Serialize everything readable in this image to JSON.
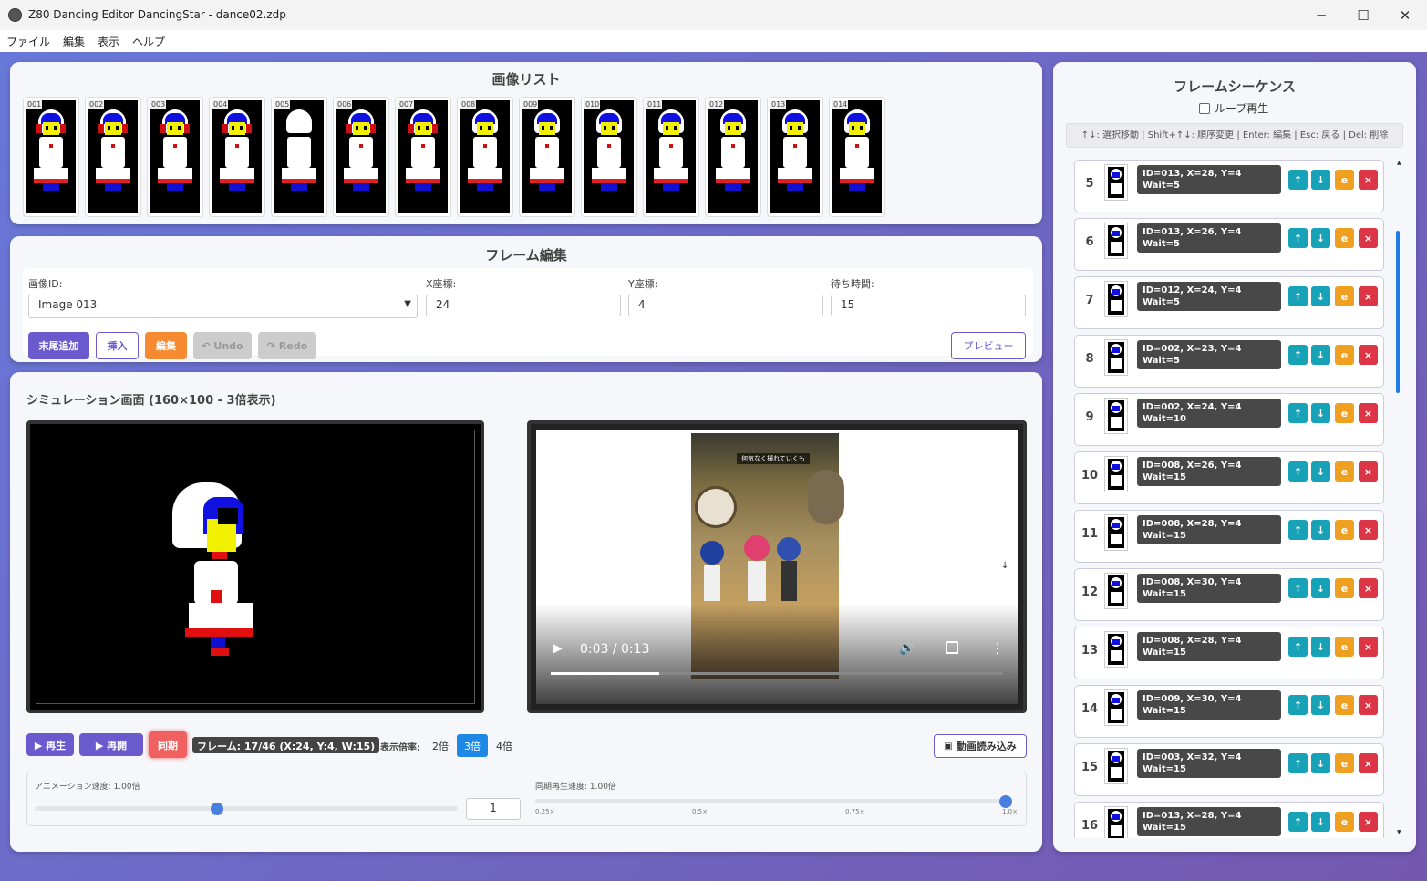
{
  "window": {
    "title": "Z80 Dancing Editor DancingStar - dance02.zdp",
    "minimize": "─",
    "maximize": "☐",
    "close": "✕"
  },
  "menu": [
    "ファイル",
    "編集",
    "表示",
    "ヘルプ"
  ],
  "image_list": {
    "title": "画像リスト",
    "images": [
      "001",
      "002",
      "003",
      "004",
      "005",
      "006",
      "007",
      "008",
      "009",
      "010",
      "011",
      "012",
      "013",
      "014"
    ]
  },
  "frame_edit": {
    "title": "フレーム編集",
    "image_id_label": "画像ID:",
    "image_id_value": "Image 013",
    "x_label": "X座標:",
    "x_value": "24",
    "y_label": "Y座標:",
    "y_value": "4",
    "wait_label": "待ち時間:",
    "wait_value": "15",
    "append": "末尾追加",
    "insert": "挿入",
    "edit": "編集",
    "undo": "↶ Undo",
    "redo": "↷ Redo",
    "preview": "プレビュー"
  },
  "simulation": {
    "title": "シミュレーション画面 (160×100 - 3倍表示)",
    "play": "▶ 再生",
    "resume": "▶ 再開",
    "sync": "同期",
    "frame_status": "フレーム: 17/46 (X:24, Y:4, W:15)",
    "zoom_label": "表示倍率:",
    "zoom_options": [
      "2倍",
      "3倍",
      "4倍"
    ],
    "zoom_selected": "3倍",
    "load_video": "動画読み込み",
    "anim_speed_label": "アニメーション速度: 1.00倍",
    "anim_speed_value": "1",
    "anim_speed_fraction": 0.43,
    "sync_speed_label": "同期再生速度: 1.00倍",
    "sync_ticks": [
      "0.25×",
      "0.5×",
      "0.75×",
      "1.0×"
    ],
    "sync_speed_fraction": 1.0
  },
  "video": {
    "time": "0:03 / 0:13",
    "progress": 0.24,
    "caption": "何気なく撮れていくも"
  },
  "sequence": {
    "title": "フレームシーケンス",
    "loop_label": "ループ再生",
    "help": "↑↓: 選択移動 | Shift+↑↓: 順序変更 | Enter: 編集 | Esc: 戻る | Del: 削除",
    "button_up": "↑",
    "button_down": "↓",
    "button_edit": "e",
    "button_remove": "×",
    "items": [
      {
        "n": "5",
        "l1": "ID=013, X=28, Y=4",
        "l2": "Wait=5"
      },
      {
        "n": "6",
        "l1": "ID=013, X=26, Y=4",
        "l2": "Wait=5"
      },
      {
        "n": "7",
        "l1": "ID=012, X=24, Y=4",
        "l2": "Wait=5"
      },
      {
        "n": "8",
        "l1": "ID=002, X=23, Y=4",
        "l2": "Wait=5"
      },
      {
        "n": "9",
        "l1": "ID=002, X=24, Y=4",
        "l2": "Wait=10"
      },
      {
        "n": "10",
        "l1": "ID=008, X=26, Y=4",
        "l2": "Wait=15"
      },
      {
        "n": "11",
        "l1": "ID=008, X=28, Y=4",
        "l2": "Wait=15"
      },
      {
        "n": "12",
        "l1": "ID=008, X=30, Y=4",
        "l2": "Wait=15"
      },
      {
        "n": "13",
        "l1": "ID=008, X=28, Y=4",
        "l2": "Wait=15"
      },
      {
        "n": "14",
        "l1": "ID=009, X=30, Y=4",
        "l2": "Wait=15"
      },
      {
        "n": "15",
        "l1": "ID=003, X=32, Y=4",
        "l2": "Wait=15"
      },
      {
        "n": "16",
        "l1": "ID=013, X=28, Y=4",
        "l2": "Wait=15"
      }
    ]
  },
  "colors": {
    "accent_purple": "#6a5acd",
    "orange": "#f58a30",
    "sync_red": "#f06060",
    "teal": "#17a2b8",
    "danger": "#dc3545",
    "zoom_active": "#1e88e5"
  }
}
